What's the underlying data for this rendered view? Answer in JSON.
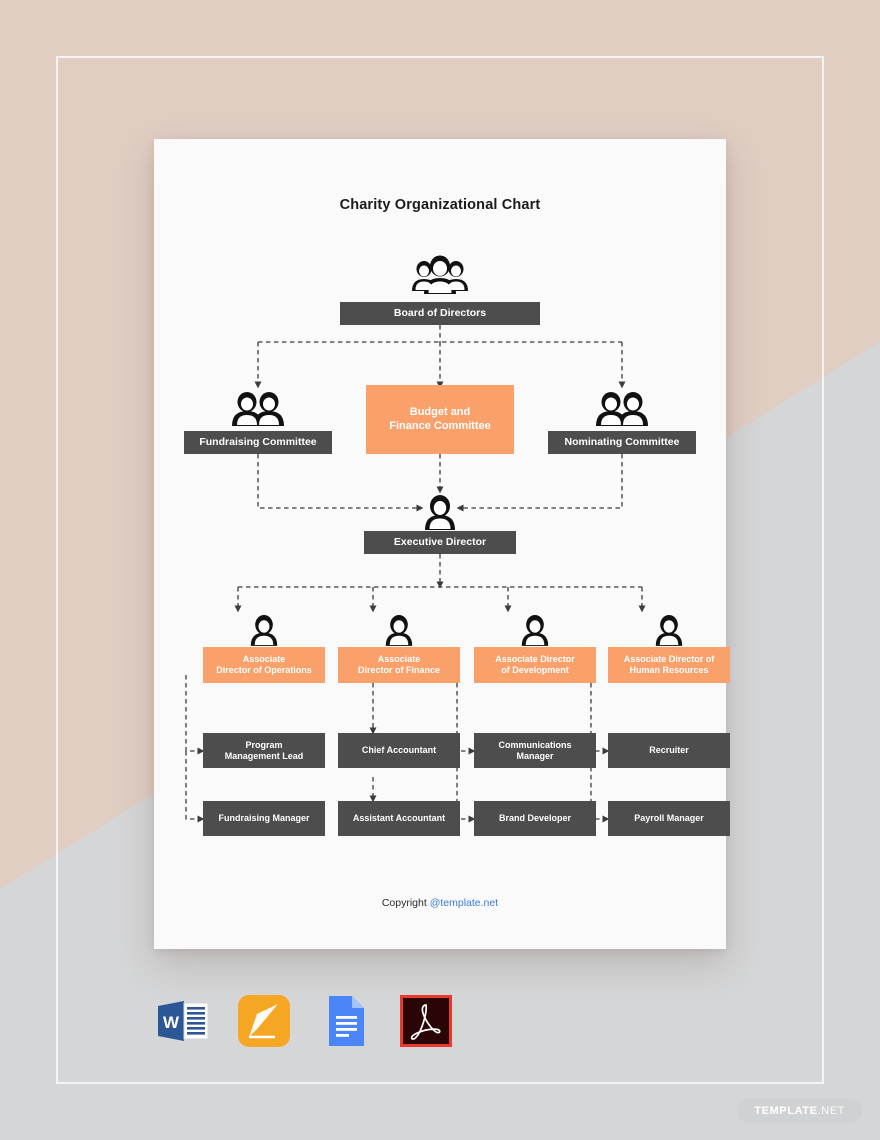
{
  "background": {
    "beige": "#e0cec3",
    "gray": "#d5d6d7",
    "frame_color": "#ffffff"
  },
  "document": {
    "title": "Charity Organizational Chart",
    "paper_color": "#fafafa",
    "copyright_prefix": "Copyright ",
    "copyright_link": "@template.net",
    "link_color": "#3b7dd8"
  },
  "theme": {
    "dark_box": "#4d4d4d",
    "orange_box": "#f9a06b",
    "box_text": "#ffffff",
    "connector": "#3c3c3c"
  },
  "chart_data": {
    "type": "diagram",
    "title": "Charity Organizational Chart",
    "diagram_kind": "organizational-chart",
    "levels": [
      {
        "level": 1,
        "nodes": [
          {
            "id": "board",
            "label": "Board of Directors",
            "style": "dark",
            "icon": "three-people-icon"
          }
        ]
      },
      {
        "level": 2,
        "nodes": [
          {
            "id": "fundraising-committee",
            "label": "Fundraising Committee",
            "style": "dark",
            "icon": "two-people-icon"
          },
          {
            "id": "budget-finance-committee",
            "label": "Budget and\nFinance Committee",
            "label_line1": "Budget and",
            "label_line2": "Finance Committee",
            "style": "orange",
            "icon": "none"
          },
          {
            "id": "nominating-committee",
            "label": "Nominating Committee",
            "style": "dark",
            "icon": "two-people-icon"
          }
        ]
      },
      {
        "level": 3,
        "nodes": [
          {
            "id": "executive-director",
            "label": "Executive Director",
            "style": "dark",
            "icon": "person-icon"
          }
        ]
      },
      {
        "level": 4,
        "nodes": [
          {
            "id": "assoc-operations",
            "label_line1": "Associate",
            "label_line2": "Director of Operations",
            "style": "orange",
            "icon": "person-icon"
          },
          {
            "id": "assoc-finance",
            "label_line1": "Associate",
            "label_line2": "Director of Finance",
            "style": "orange",
            "icon": "person-icon"
          },
          {
            "id": "assoc-development",
            "label_line1": "Associate Director",
            "label_line2": "of Development",
            "style": "orange",
            "icon": "person-icon"
          },
          {
            "id": "assoc-hr",
            "label_line1": "Associate Director of",
            "label_line2": "Human Resources",
            "style": "orange",
            "icon": "person-icon"
          }
        ]
      },
      {
        "level": 5,
        "nodes": [
          {
            "id": "program-management-lead",
            "label_line1": "Program",
            "label_line2": "Management Lead",
            "style": "dark",
            "parent": "assoc-operations"
          },
          {
            "id": "chief-accountant",
            "label_line1": "Chief Accountant",
            "label_line2": "",
            "style": "dark",
            "parent": "assoc-finance"
          },
          {
            "id": "communications-manager",
            "label_line1": "Communications",
            "label_line2": "Manager",
            "style": "dark",
            "parent": "assoc-development"
          },
          {
            "id": "recruiter",
            "label_line1": "Recruiter",
            "label_line2": "",
            "style": "dark",
            "parent": "assoc-hr"
          }
        ]
      },
      {
        "level": 6,
        "nodes": [
          {
            "id": "fundraising-manager",
            "label_line1": "Fundraising Manager",
            "label_line2": "",
            "style": "dark",
            "parent": "assoc-operations"
          },
          {
            "id": "assistant-accountant",
            "label_line1": "Assistant Accountant",
            "label_line2": "",
            "style": "dark",
            "parent": "chief-accountant"
          },
          {
            "id": "brand-developer",
            "label_line1": "Brand Developer",
            "label_line2": "",
            "style": "dark",
            "parent": "assoc-development"
          },
          {
            "id": "payroll-manager",
            "label_line1": "Payroll Manager",
            "label_line2": "",
            "style": "dark",
            "parent": "assoc-hr"
          }
        ]
      }
    ]
  },
  "formats": [
    {
      "id": "word",
      "name": "ms-word-icon",
      "glyph": "W"
    },
    {
      "id": "pages",
      "name": "apple-pages-icon",
      "glyph": ""
    },
    {
      "id": "docs",
      "name": "google-docs-icon",
      "glyph": ""
    },
    {
      "id": "pdf",
      "name": "adobe-pdf-icon",
      "glyph": "A"
    }
  ],
  "watermark": {
    "bold": "TEMPLATE",
    "light": ".NET"
  }
}
